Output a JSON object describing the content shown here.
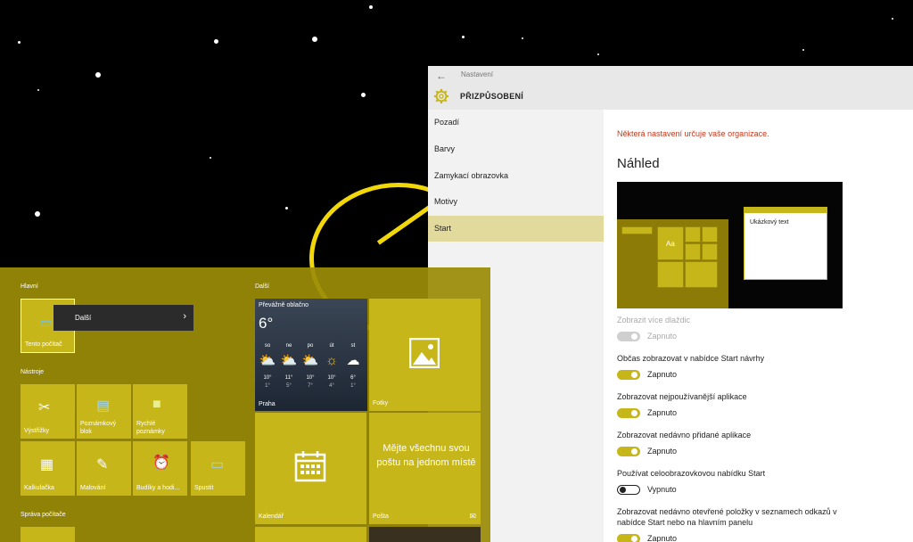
{
  "settings": {
    "window_title": "Nastavení",
    "section_title": "PŘIZPŮSOBENÍ",
    "nav": [
      {
        "label": "Pozadí"
      },
      {
        "label": "Barvy"
      },
      {
        "label": "Zamykací obrazovka"
      },
      {
        "label": "Motivy"
      },
      {
        "label": "Start"
      }
    ],
    "active_nav": "Start",
    "org_notice": "Některá nastavení určuje vaše organizace.",
    "preview_title": "Náhled",
    "preview": {
      "sample_text": "Ukázkový text",
      "tile_text": "Aa"
    },
    "options": [
      {
        "label": "Zobrazit více dlaždic",
        "state": "Zapnuto",
        "on": true,
        "disabled": true
      },
      {
        "label": "Občas zobrazovat v nabídce Start návrhy",
        "state": "Zapnuto",
        "on": true,
        "disabled": false
      },
      {
        "label": "Zobrazovat nejpoužívanější aplikace",
        "state": "Zapnuto",
        "on": true,
        "disabled": false
      },
      {
        "label": "Zobrazovat nedávno přidané aplikace",
        "state": "Zapnuto",
        "on": true,
        "disabled": false
      },
      {
        "label": "Používat celoobrazovkovou nabídku Start",
        "state": "Vypnuto",
        "on": false,
        "disabled": false
      },
      {
        "label_line1": "Zobrazovat nedávno otevřené položky v seznamech odkazů v",
        "label_line2": "nabídce Start nebo na hlavním panelu",
        "state": "Zapnuto",
        "on": true,
        "disabled": false
      }
    ],
    "accent_color": "#c7b61a",
    "warning_color": "#c5391f"
  },
  "start_menu": {
    "groups": {
      "main": "Hlavní",
      "tools": "Nástroje",
      "manage": "Správa počítače",
      "more": "Další"
    },
    "tiles": {
      "this_pc": "Tento počítač",
      "snipping": "Výstřižky",
      "notepad": "Poznámkový blok",
      "sticky": "Rychlé poznámky",
      "calc": "Kalkulačka",
      "paint": "Malování",
      "alarms": "Budíky a hodi...",
      "run": "Spustit",
      "photos": "Fotky",
      "calendar": "Kalendář",
      "mail": "Pošta",
      "mail_promo": "Mějte všechnu svou poštu na jednom místě"
    },
    "context_menu": {
      "label": "Další"
    },
    "weather": {
      "condition": "Převážně oblačno",
      "temp": "6°",
      "city": "Praha",
      "days": [
        {
          "day": "so",
          "icon": "partly-cloudy",
          "hi": "10°",
          "lo": "1°"
        },
        {
          "day": "ne",
          "icon": "partly-cloudy",
          "hi": "11°",
          "lo": "5°"
        },
        {
          "day": "po",
          "icon": "partly-cloudy",
          "hi": "10°",
          "lo": "7°"
        },
        {
          "day": "út",
          "icon": "sunny",
          "hi": "10°",
          "lo": "4°"
        },
        {
          "day": "st",
          "icon": "cloudy",
          "hi": "6°",
          "lo": "1°"
        }
      ]
    }
  }
}
